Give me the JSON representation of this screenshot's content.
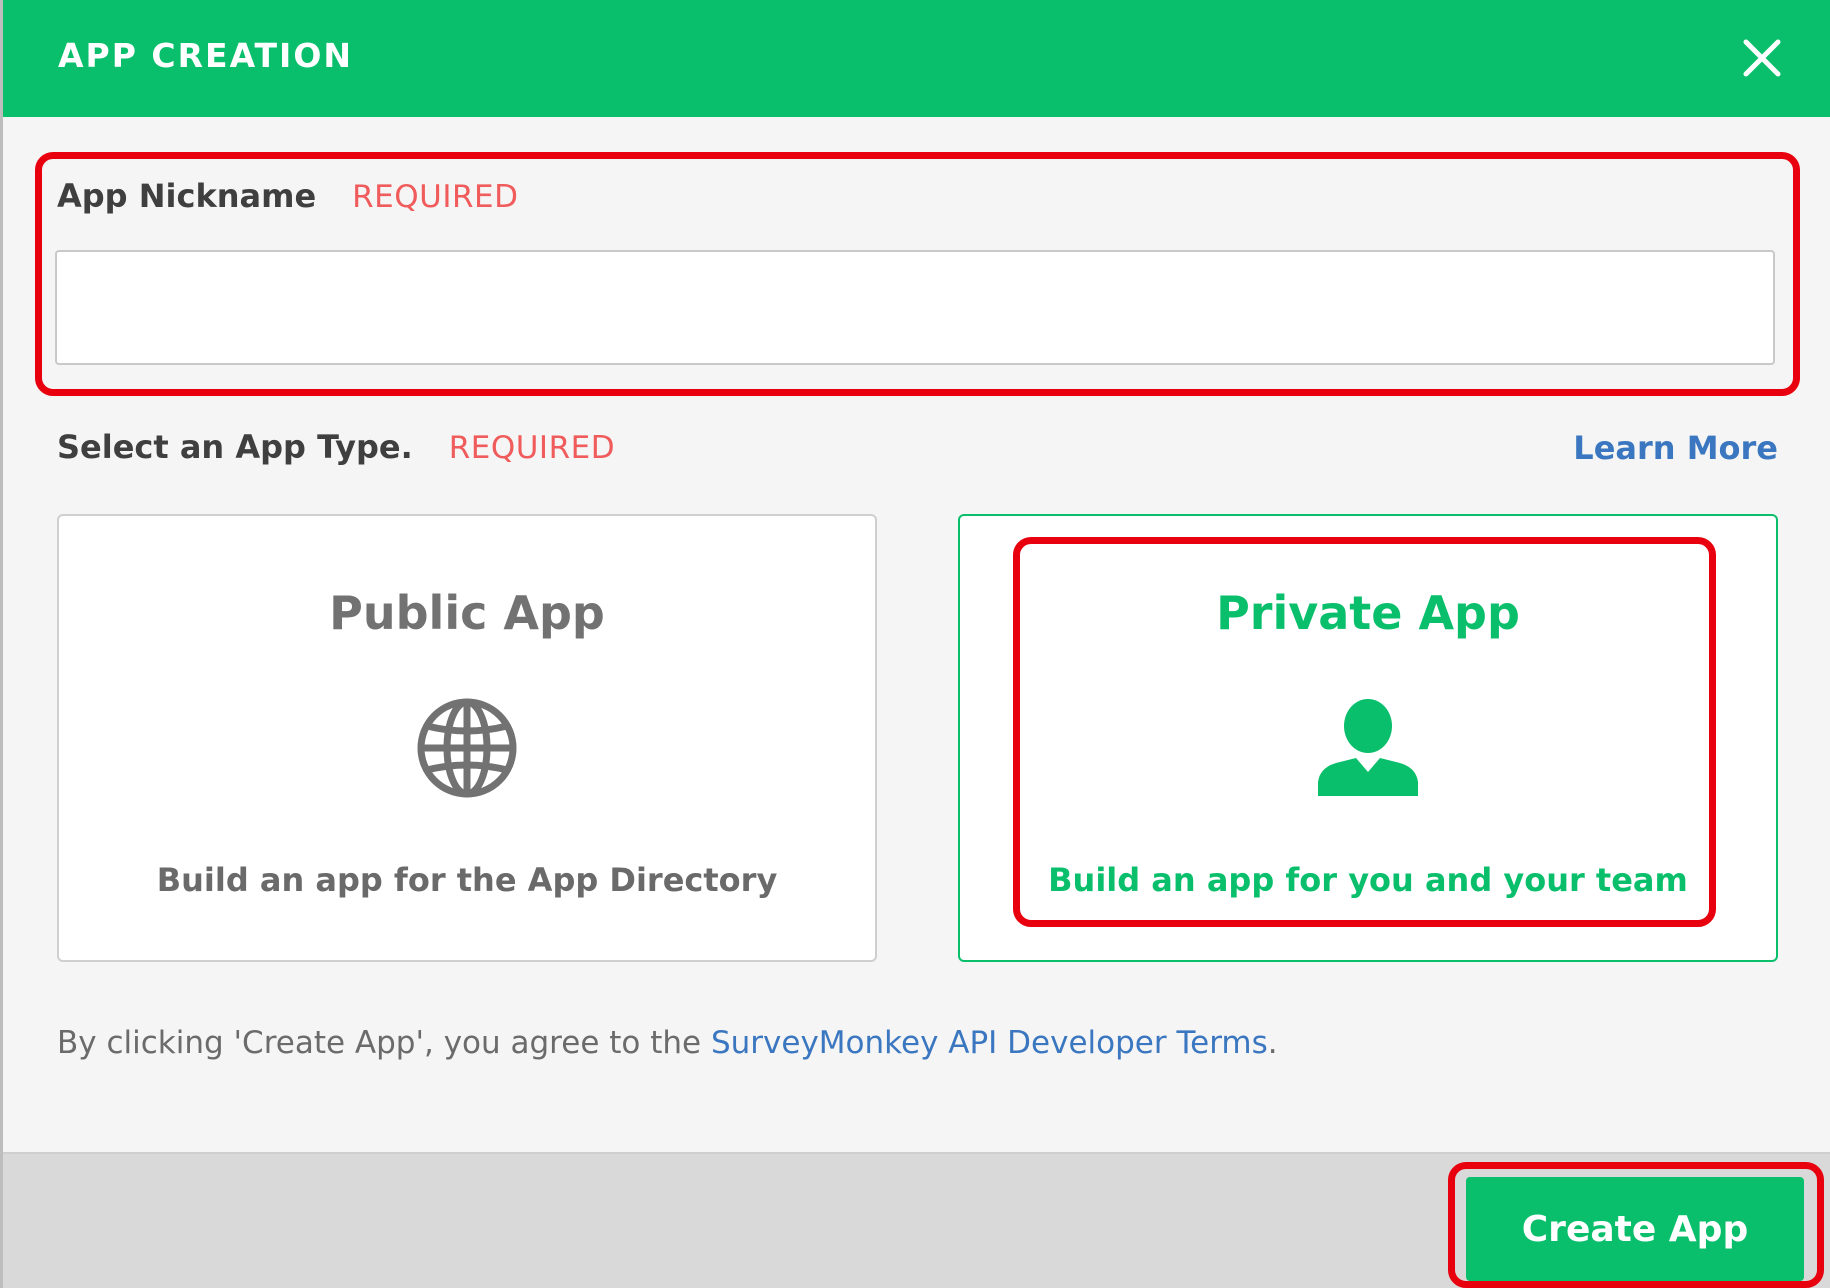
{
  "dialog": {
    "title": "APP CREATION",
    "close_icon": "close-icon"
  },
  "nickname": {
    "label": "App Nickname",
    "required": "REQUIRED",
    "value": "",
    "placeholder": ""
  },
  "app_type": {
    "label": "Select an App Type.",
    "required": "REQUIRED",
    "learn_more": "Learn More",
    "selected": "private",
    "options": [
      {
        "key": "public",
        "title": "Public App",
        "icon": "globe-icon",
        "description": "Build an app for the App Directory"
      },
      {
        "key": "private",
        "title": "Private App",
        "icon": "person-icon",
        "description": "Build an app for you and your team"
      }
    ]
  },
  "terms": {
    "prefix": "By clicking 'Create App', you agree to the ",
    "link": "SurveyMonkey API Developer Terms",
    "suffix": "."
  },
  "footer": {
    "create_label": "Create App"
  },
  "colors": {
    "brand_green": "#0abf6c",
    "required_red": "#f05b5b",
    "link_blue": "#3b77c0",
    "annotation_red": "#e8000e"
  }
}
